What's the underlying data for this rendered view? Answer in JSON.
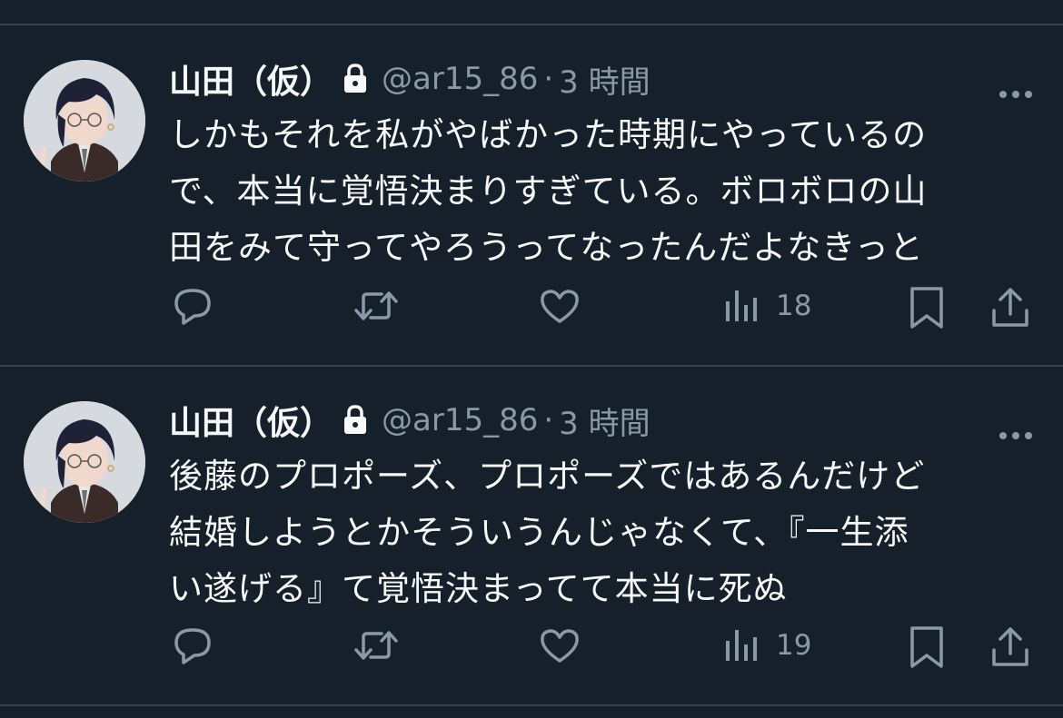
{
  "tweets": [
    {
      "author_name": "山田（仮）",
      "handle": "@ar15_86",
      "separator": "·",
      "time": "3 時間",
      "text_lines": [
        "しかもそれを私がやばかった時期にやっているの",
        "で、本当に覚悟決まりすぎている。ボロボロの山",
        "田をみて守ってやろうってなったんだよなきっと"
      ],
      "views": "18",
      "protected_icon": "lock-icon"
    },
    {
      "author_name": "山田（仮）",
      "handle": "@ar15_86",
      "separator": "·",
      "time": "3 時間",
      "text_lines": [
        "後藤のプロポーズ、プロポーズではあるんだけど",
        "結婚しようとかそういうんじゃなくて、『一生添",
        "い遂げる』て覚悟決まってて本当に死ぬ"
      ],
      "views": "19",
      "protected_icon": "lock-icon"
    }
  ],
  "icons": [
    "more-icon",
    "reply-icon",
    "retweet-icon",
    "like-icon",
    "views-icon",
    "bookmark-icon",
    "share-icon"
  ],
  "colors": {
    "background": "#15202b",
    "divider": "#38444d",
    "primary_text": "#f7f9f9",
    "secondary_text": "#8b98a5"
  }
}
